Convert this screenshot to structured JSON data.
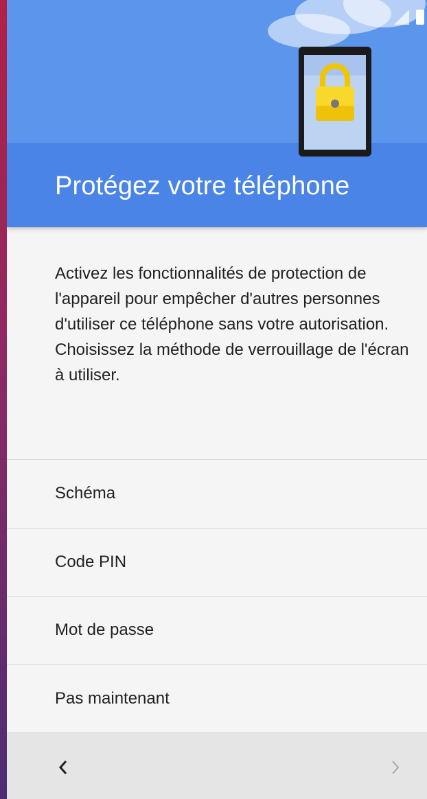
{
  "colors": {
    "header_accent": "#4a84e6",
    "header_light": "#5b95ec",
    "background": "#f5f5f5",
    "footer": "#e5e5e5",
    "frame_gradient_top": "#b21f47",
    "frame_gradient_bottom": "#4d2d74"
  },
  "status_bar": {
    "icons": [
      "no-signal-icon",
      "battery-icon"
    ]
  },
  "header": {
    "illustration": "phone-lock-icon",
    "title": "Protégez votre téléphone"
  },
  "description": "Activez les fonctionnalités de protection de l'appareil pour empêcher d'autres personnes d'utiliser ce téléphone sans votre autorisation. Choisissez la méthode de verrouillage de l'écran à utiliser.",
  "options": [
    {
      "label": "Schéma"
    },
    {
      "label": "Code PIN"
    },
    {
      "label": "Mot de passe"
    },
    {
      "label": "Pas maintenant"
    }
  ],
  "footer": {
    "back_icon": "chevron-left-icon",
    "next_icon": "chevron-right-icon"
  }
}
